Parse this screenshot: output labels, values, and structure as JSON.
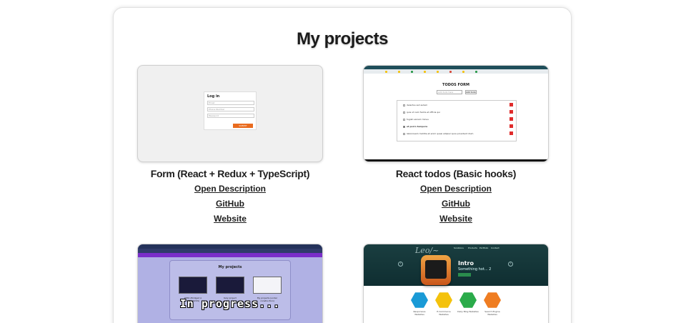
{
  "page": {
    "title": "My projects"
  },
  "projects": [
    {
      "title": "Form (React + Redux + TypeScript)",
      "links": {
        "description": "Open Description",
        "github": "GitHub",
        "website": "Website"
      },
      "thumb": {
        "form_title": "Log in",
        "fields": [
          "Email",
          "Phone Number",
          "Password"
        ],
        "button": "SUBMIT"
      }
    },
    {
      "title": "React todos (Basic hooks)",
      "links": {
        "description": "Open Description",
        "github": "GitHub",
        "website": "Website"
      },
      "thumb": {
        "heading": "TODOS FORM",
        "input_placeholder": "Add todo here",
        "button": "Add todo",
        "items": [
          "delectus aut autem",
          "quis ut nam facilis et officia qui",
          "fugiat veniam minus",
          "et porro tempora",
          "laboriosam mollitia et enim quasi adipisci quia provident illum"
        ]
      }
    },
    {
      "thumb": {
        "inner_title": "My projects",
        "cards": [
          "WHO (Bridged A HTML/SCSS)",
          "Kaly project",
          "My projects (under construction)"
        ],
        "overlay": "In progress..."
      }
    },
    {
      "thumb": {
        "brand": "Leo/~",
        "nav": [
          "Solutions",
          "Products",
          "Portfolio",
          "Contact"
        ],
        "intro": "Intro",
        "subtitle": "Something hot... 2",
        "features": [
          "Responsive Websites",
          "E-Commerce Websites",
          "Daily Blog Websites",
          "Search Engine Websites"
        ],
        "colors": {
          "blue": "#1a9ad6",
          "yellow": "#f4c20d",
          "green": "#2bab4a",
          "orange": "#ef7d22"
        }
      }
    }
  ],
  "colors": {
    "title": "#1b1b1b",
    "accent_orange": "#e96b1e",
    "todo_delete": "#e02b2b",
    "progress_bg": "#b0b1e4"
  }
}
